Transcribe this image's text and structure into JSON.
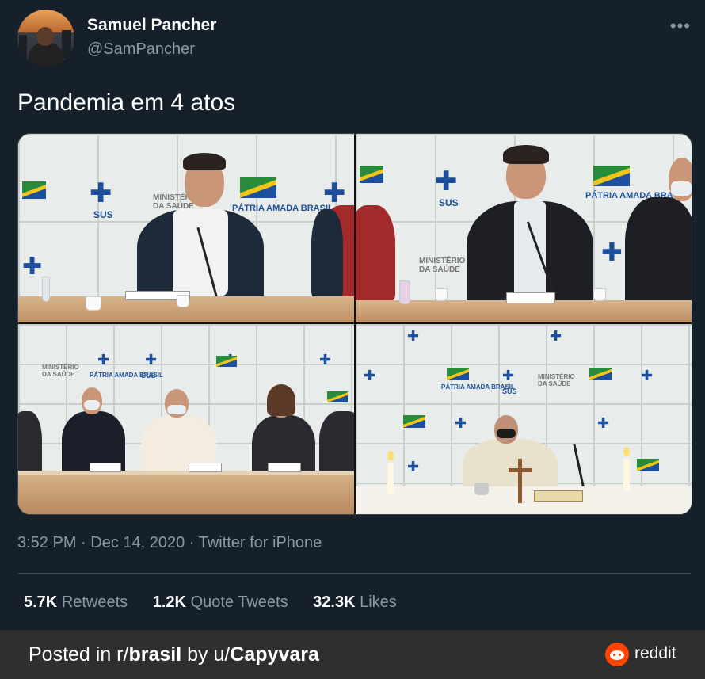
{
  "author": {
    "name": "Samuel Pancher",
    "handle": "@SamPancher",
    "avatar_icon": "user-avatar-photo"
  },
  "more_icon": "more-options-icon",
  "more_glyph": "•••",
  "tweet_text": "Pandemia em 4 atos",
  "media": {
    "panels": [
      {
        "signs": [
          "SUS",
          "MINISTÉRIO DA SAÚDE",
          "PÁTRIA AMADA BRASIL"
        ]
      },
      {
        "signs": [
          "SUS",
          "MINISTÉRIO DA SAÚDE",
          "PÁTRIA AMADA BRASIL"
        ]
      },
      {
        "signs": [
          "SUS",
          "MINISTÉRIO DA SAÚDE",
          "PÁTRIA AMADA BRASIL"
        ]
      },
      {
        "signs": [
          "SUS",
          "MINISTÉRIO DA SAÚDE",
          "PÁTRIA AMADA BRASIL"
        ]
      }
    ]
  },
  "meta": {
    "time": "3:52 PM",
    "date": "Dec 14, 2020",
    "source": "Twitter for iPhone"
  },
  "stats": {
    "retweets_count": "5.7K",
    "retweets_label": "Retweets",
    "quotes_count": "1.2K",
    "quotes_label": "Quote Tweets",
    "likes_count": "32.3K",
    "likes_label": "Likes"
  },
  "footer": {
    "posted_prefix": "Posted in r/",
    "subreddit": "brasil",
    "by_prefix": " by u/",
    "user": "Capyvara",
    "brand": "reddit",
    "brand_icon": "reddit-logo-icon",
    "brand_color": "#ff4500"
  }
}
